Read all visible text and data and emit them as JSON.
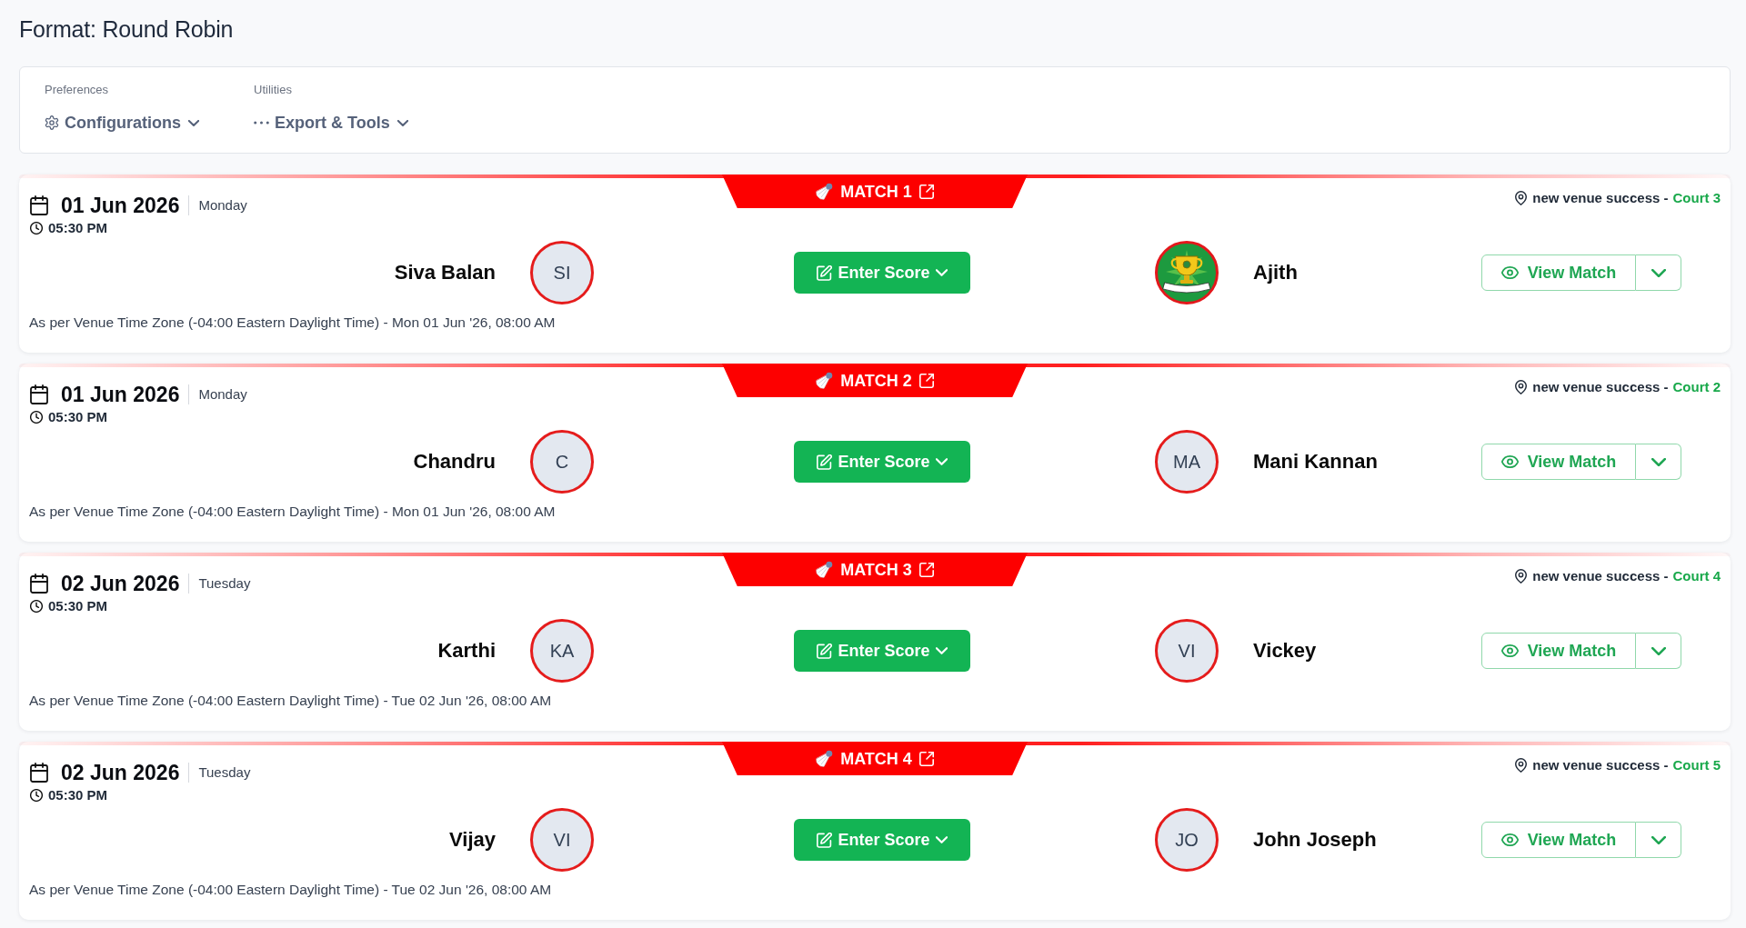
{
  "title": "Format: Round Robin",
  "toolbar": {
    "groups": [
      {
        "label": "Preferences",
        "kind": "gear",
        "button": "Configurations"
      },
      {
        "label": "Utilities",
        "kind": "dots",
        "button": "Export & Tools"
      }
    ]
  },
  "matches": [
    {
      "label": "MATCH 1",
      "date": "01 Jun 2026",
      "weekday": "Monday",
      "time": "05:30 PM",
      "venue": "new venue success -",
      "court": "Court 3",
      "player_1": {
        "name": "Siva Balan",
        "avatar": {
          "kind": "initials",
          "text": "SI"
        }
      },
      "score_button": "Enter Score",
      "player_2": {
        "name": "Ajith",
        "avatar": {
          "kind": "logo"
        }
      },
      "view_button": "View Match",
      "timezone_note": "As per Venue Time Zone (-04:00 Eastern Daylight Time) - Mon 01 Jun '26, 08:00 AM"
    },
    {
      "label": "MATCH 2",
      "date": "01 Jun 2026",
      "weekday": "Monday",
      "time": "05:30 PM",
      "venue": "new venue success -",
      "court": "Court 2",
      "player_1": {
        "name": "Chandru",
        "avatar": {
          "kind": "initials",
          "text": "C"
        }
      },
      "score_button": "Enter Score",
      "player_2": {
        "name": "Mani Kannan",
        "avatar": {
          "kind": "initials",
          "text": "MA"
        }
      },
      "view_button": "View Match",
      "timezone_note": "As per Venue Time Zone (-04:00 Eastern Daylight Time) - Mon 01 Jun '26, 08:00 AM"
    },
    {
      "label": "MATCH 3",
      "date": "02 Jun 2026",
      "weekday": "Tuesday",
      "time": "05:30 PM",
      "venue": "new venue success -",
      "court": "Court 4",
      "player_1": {
        "name": "Karthi",
        "avatar": {
          "kind": "initials",
          "text": "KA"
        }
      },
      "score_button": "Enter Score",
      "player_2": {
        "name": "Vickey",
        "avatar": {
          "kind": "initials",
          "text": "VI"
        }
      },
      "view_button": "View Match",
      "timezone_note": "As per Venue Time Zone (-04:00 Eastern Daylight Time) - Tue 02 Jun '26, 08:00 AM"
    },
    {
      "label": "MATCH 4",
      "date": "02 Jun 2026",
      "weekday": "Tuesday",
      "time": "05:30 PM",
      "venue": "new venue success -",
      "court": "Court 5",
      "player_1": {
        "name": "Vijay",
        "avatar": {
          "kind": "initials",
          "text": "VI"
        }
      },
      "score_button": "Enter Score",
      "player_2": {
        "name": "John Joseph",
        "avatar": {
          "kind": "initials",
          "text": "JO"
        }
      },
      "view_button": "View Match",
      "timezone_note": "As per Venue Time Zone (-04:00 Eastern Daylight Time) - Tue 02 Jun '26, 08:00 AM"
    }
  ]
}
